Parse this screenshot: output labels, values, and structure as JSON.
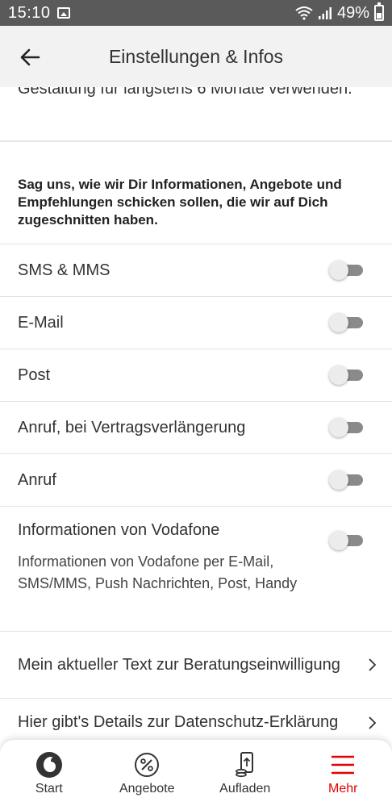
{
  "status_bar": {
    "time": "15:10",
    "battery": "49%"
  },
  "header": {
    "title": "Einstellungen & Infos"
  },
  "partial_text": "Gestaltung für längstens 6 Monate verwenden.",
  "intro": "Sag uns, wie wir Dir Informationen, Angebote und Empfehlungen schicken sollen, die wir auf Dich zugeschnitten haben.",
  "toggles": [
    {
      "label": "SMS & MMS",
      "on": false
    },
    {
      "label": "E-Mail",
      "on": false
    },
    {
      "label": "Post",
      "on": false
    },
    {
      "label": "Anruf, bei Vertragsverlängerung",
      "on": false
    },
    {
      "label": "Anruf",
      "on": false
    }
  ],
  "vodafone_info": {
    "label": "Informationen von Vodafone",
    "description": "Informationen von Vodafone per E-Mail, SMS/MMS, Push Nachrichten, Post, Handy",
    "on": false
  },
  "links": [
    {
      "label": "Mein aktueller Text zur Beratungseinwilligung"
    },
    {
      "label": "Hier gibt's Details zur Datenschutz-Erklärung"
    }
  ],
  "bottom_nav": [
    {
      "label": "Start",
      "icon": "vodafone-logo-icon",
      "active": false
    },
    {
      "label": "Angebote",
      "icon": "percent-badge-icon",
      "active": false
    },
    {
      "label": "Aufladen",
      "icon": "phone-coins-icon",
      "active": false
    },
    {
      "label": "Mehr",
      "icon": "hamburger-menu-icon",
      "active": true
    }
  ],
  "colors": {
    "accent": "#e60000",
    "header_bg": "#f2f2f2",
    "status_bg": "#5a5a5a"
  }
}
